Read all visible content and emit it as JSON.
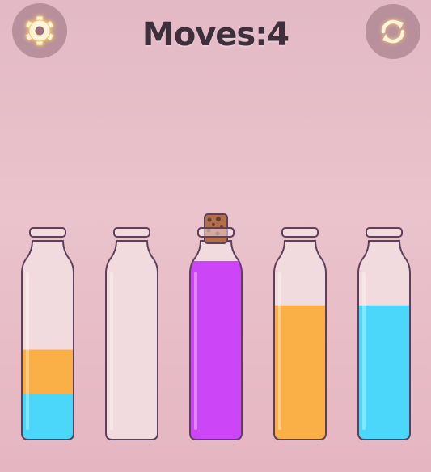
{
  "hud": {
    "moves_label": "Moves:",
    "moves_value": "4",
    "settings_icon": "gear-icon",
    "restart_icon": "refresh-icon"
  },
  "colors": {
    "orange": "#fbb047",
    "blue": "#4bd7f9",
    "purple": "#cc45f7",
    "glass": "#f2dbde",
    "outline": "#5e405d",
    "cork": "#b26f4c"
  },
  "bottles": [
    {
      "name": "bottle-1",
      "corked": false,
      "layers": [
        {
          "color": "blue",
          "fraction": 0.25
        },
        {
          "color": "orange",
          "fraction": 0.25
        }
      ]
    },
    {
      "name": "bottle-2",
      "corked": false,
      "layers": []
    },
    {
      "name": "bottle-3",
      "corked": true,
      "layers": [
        {
          "color": "purple",
          "fraction": 1.0
        }
      ]
    },
    {
      "name": "bottle-4",
      "corked": false,
      "layers": [
        {
          "color": "orange",
          "fraction": 0.75
        }
      ]
    },
    {
      "name": "bottle-5",
      "corked": false,
      "layers": [
        {
          "color": "blue",
          "fraction": 0.75
        }
      ]
    }
  ]
}
